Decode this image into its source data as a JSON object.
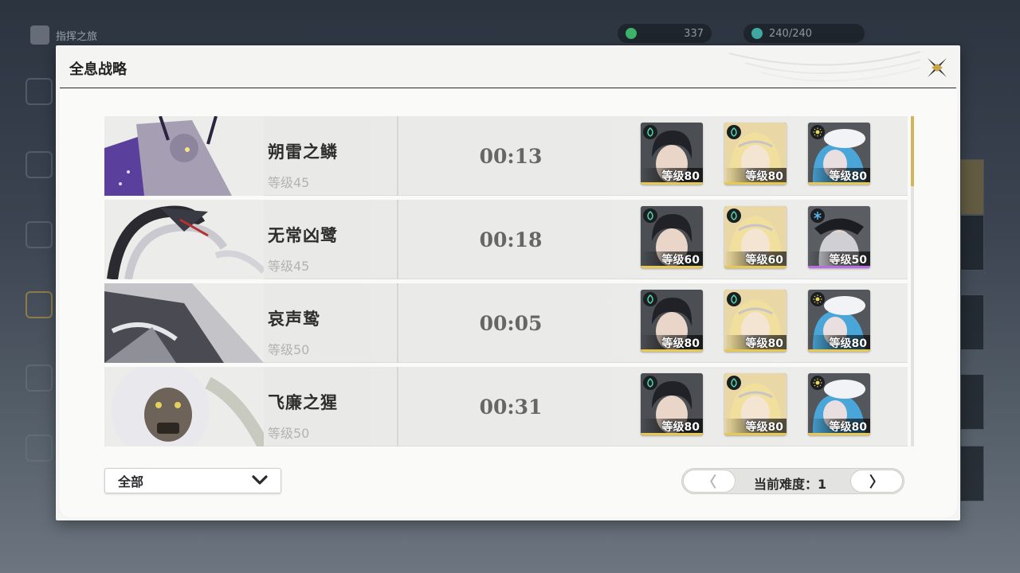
{
  "hud": {
    "home_label": "指挥之旅",
    "currency_value": "337",
    "stamina_value": "240/240"
  },
  "dialog": {
    "title": "全息战略"
  },
  "bosses": [
    {
      "name": "朔雷之鳞",
      "level": "等级45",
      "time": "00:13",
      "team": [
        {
          "level": "等级80",
          "element": "aero",
          "rarity": "gold"
        },
        {
          "level": "等级80",
          "element": "aero",
          "rarity": "gold"
        },
        {
          "level": "等级80",
          "element": "spectro",
          "rarity": "gold"
        }
      ]
    },
    {
      "name": "无常凶鹭",
      "level": "等级45",
      "time": "00:18",
      "team": [
        {
          "level": "等级60",
          "element": "aero",
          "rarity": "gold"
        },
        {
          "level": "等级60",
          "element": "aero",
          "rarity": "gold"
        },
        {
          "level": "等级50",
          "element": "glacio",
          "rarity": "purple"
        }
      ]
    },
    {
      "name": "哀声鸷",
      "level": "等级50",
      "time": "00:05",
      "team": [
        {
          "level": "等级80",
          "element": "aero",
          "rarity": "gold"
        },
        {
          "level": "等级80",
          "element": "aero",
          "rarity": "gold"
        },
        {
          "level": "等级80",
          "element": "spectro",
          "rarity": "gold"
        }
      ]
    },
    {
      "name": "飞廉之猩",
      "level": "等级50",
      "time": "00:31",
      "team": [
        {
          "level": "等级80",
          "element": "aero",
          "rarity": "gold"
        },
        {
          "level": "等级80",
          "element": "aero",
          "rarity": "gold"
        },
        {
          "level": "等级80",
          "element": "spectro",
          "rarity": "gold"
        }
      ]
    }
  ],
  "filter": {
    "selected": "全部"
  },
  "pager": {
    "prev_symbol": "〈",
    "next_symbol": "〉",
    "difficulty_label": "当前难度：1"
  },
  "colors": {
    "rarity_gold": "#e8c855",
    "rarity_purple": "#b86ee0",
    "aero": "#4fd6a8",
    "spectro": "#e9d65a",
    "glacio": "#5ab6ee"
  }
}
